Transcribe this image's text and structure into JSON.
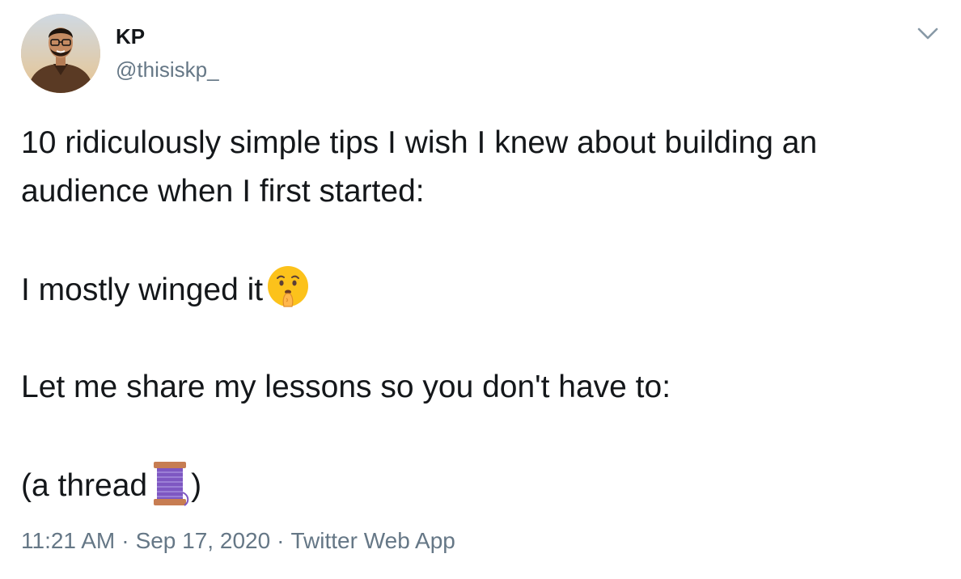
{
  "author": {
    "name": "KP",
    "handle": "@thisiskp_"
  },
  "tweet": {
    "line1": "10 ridiculously simple tips I wish I knew about building an",
    "line2": "audience when I first started:",
    "line3": "I mostly winged it",
    "line4": "Let me share my lessons so you don't have to:",
    "line5_start": "(a thread",
    "line5_end": ")"
  },
  "meta": {
    "time": "11:21 AM",
    "date": "Sep 17, 2020",
    "separator": "·",
    "source": "Twitter Web App"
  },
  "icons": {
    "menu": "chevron-down-icon",
    "emoji1": "shushing-face-emoji",
    "emoji2": "spool-of-thread-emoji"
  },
  "colors": {
    "text": "#14171a",
    "secondary": "#657786"
  }
}
